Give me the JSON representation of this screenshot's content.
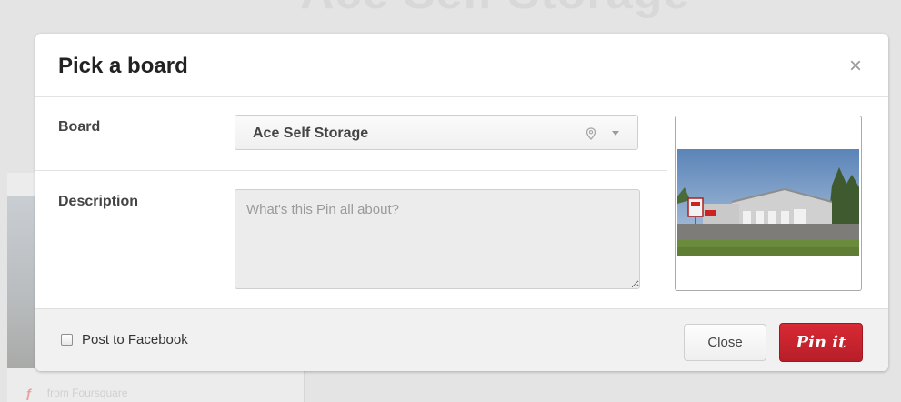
{
  "background": {
    "page_title": "Ace Self Storage",
    "source_text": "from Foursquare"
  },
  "dialog": {
    "title": "Pick a board",
    "close_icon": "×",
    "board_label": "Board",
    "board_value": "Ace Self Storage",
    "description_label": "Description",
    "description_placeholder": "What's this Pin all about?",
    "description_value": "",
    "image_alt": "Ace Self Storage building photo"
  },
  "footer": {
    "checkbox_label": "Post to Facebook",
    "checkbox_checked": false,
    "close_label": "Close",
    "pinit_label": "Pin it"
  },
  "colors": {
    "pinit_red": "#c8232c",
    "overlay": "#e4e4e4"
  }
}
